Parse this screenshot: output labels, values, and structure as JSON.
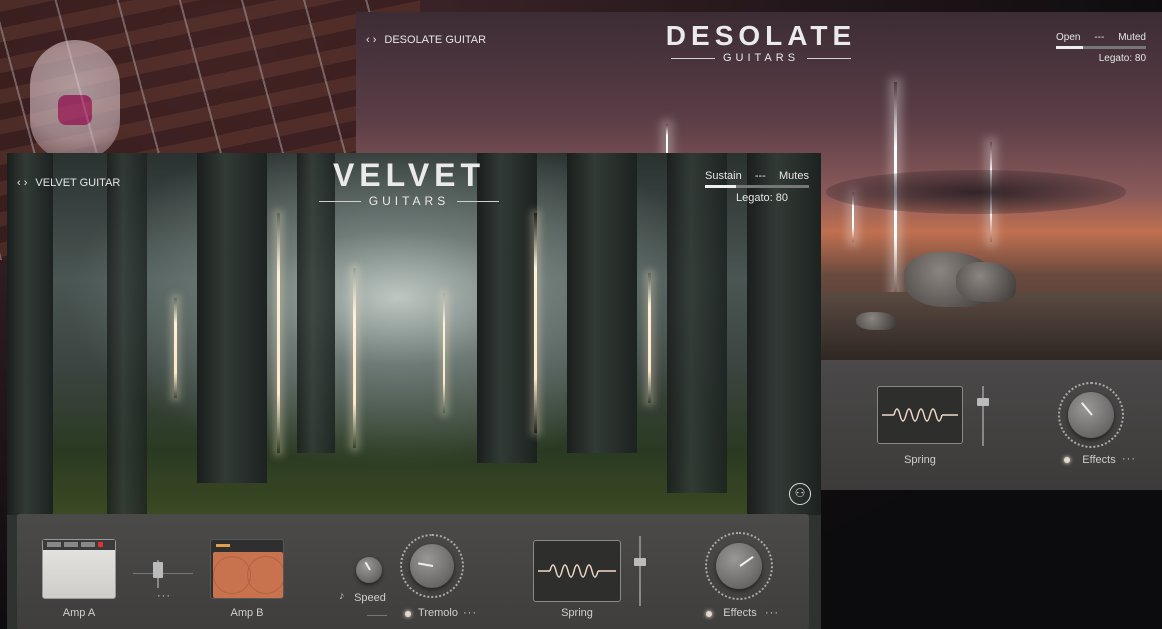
{
  "desolate": {
    "nav_title": "DESOLATE GUITAR",
    "logo_big": "DESOLATE",
    "logo_small": "GUITARS",
    "top_right": {
      "left": "Open",
      "middle": "---",
      "right": "Muted",
      "legato": "Legato: 80"
    },
    "panel": {
      "spring_label": "Spring",
      "effects_label": "Effects",
      "dots": "···"
    }
  },
  "velvet": {
    "nav_title": "VELVET GUITAR",
    "logo_big": "VELVET",
    "logo_small": "GUITARS",
    "top_right": {
      "left": "Sustain",
      "middle": "---",
      "right": "Mutes",
      "legato": "Legato: 80"
    },
    "panel": {
      "amp_a_label": "Amp A",
      "amp_b_label": "Amp B",
      "speed_label": "Speed",
      "tremolo_label": "Tremolo",
      "spring_label": "Spring",
      "effects_label": "Effects",
      "dots": "···"
    },
    "nav_icons": "‹ ›",
    "figure_icon": "accessibility-icon"
  }
}
